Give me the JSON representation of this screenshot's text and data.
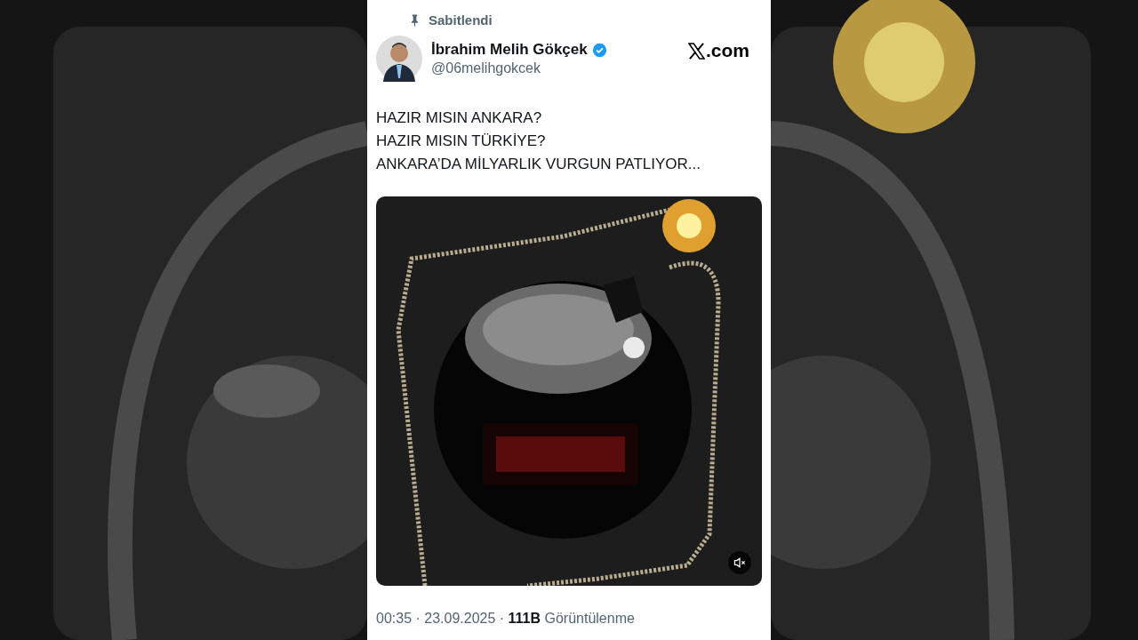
{
  "pinned": {
    "label": "Sabitlendi"
  },
  "author": {
    "name": "İbrahim Melih Gökçek",
    "verified": true,
    "handle": "@06melihgokcek"
  },
  "brand": {
    "label": ".com"
  },
  "text_lines": [
    "HAZIR MISIN ANKARA?",
    "HAZIR MISIN TÜRKİYE?",
    "ANKARA’DA MİLYARLIK VURGUN PATLIYOR..."
  ],
  "video": {
    "kind": "picture",
    "muted": true
  },
  "meta": "00:35 · 23.09.2025 · **111B** Görüntülenme"
}
